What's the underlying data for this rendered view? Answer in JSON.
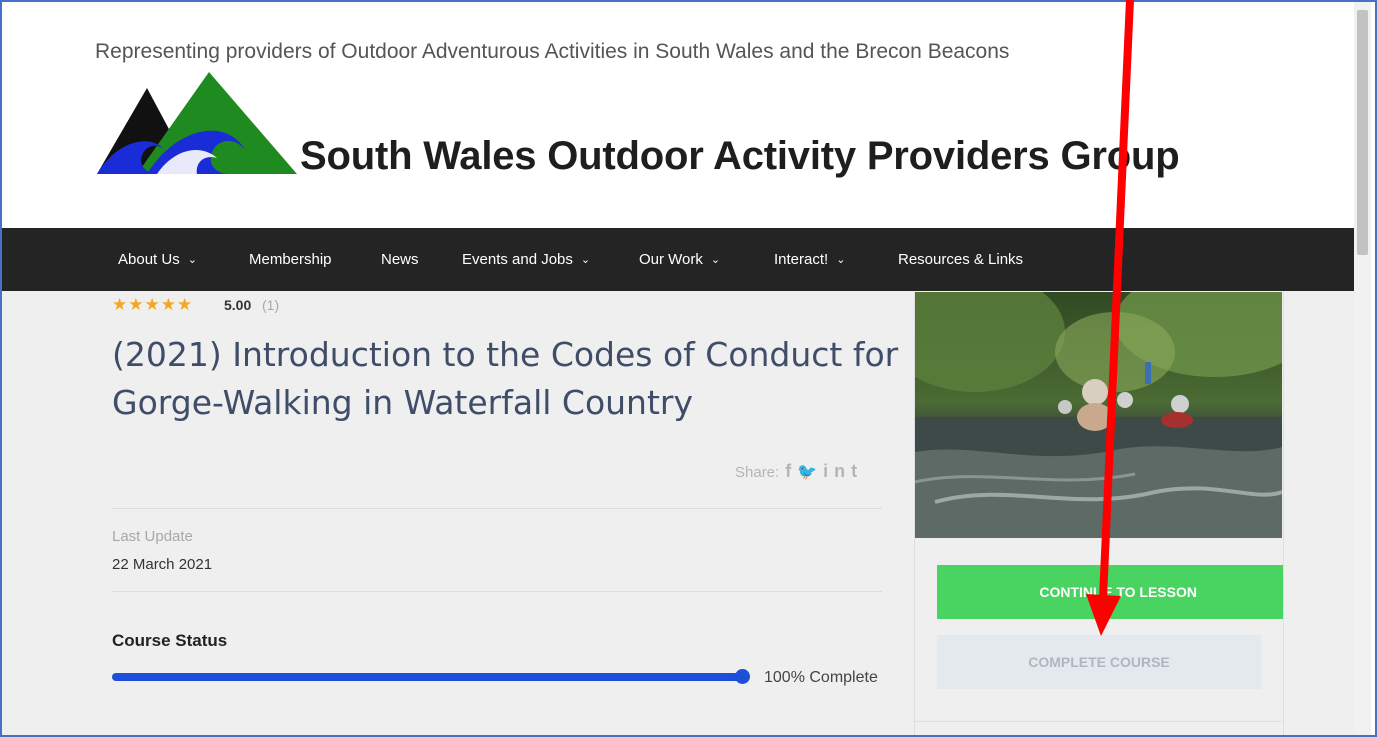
{
  "header": {
    "tagline": "Representing providers of Outdoor Adventurous Activities in South Wales and the Brecon Beacons",
    "site_title": "South Wales Outdoor Activity Providers Group",
    "logo_colors": {
      "black_peak": "#111111",
      "green_peak": "#1f8a1f",
      "wave": "#1a2bd8"
    }
  },
  "nav": {
    "items": [
      {
        "label": "About Us",
        "has_dropdown": true
      },
      {
        "label": "Membership",
        "has_dropdown": false
      },
      {
        "label": "News",
        "has_dropdown": false
      },
      {
        "label": "Events and Jobs",
        "has_dropdown": true
      },
      {
        "label": "Our Work",
        "has_dropdown": true
      },
      {
        "label": "Interact!",
        "has_dropdown": true
      },
      {
        "label": "Resources & Links",
        "has_dropdown": false
      }
    ],
    "dropdown_icon": "chevron-down-icon",
    "background": "#242424"
  },
  "course": {
    "rating": {
      "stars": 5,
      "value": "5.00",
      "count": "(1)"
    },
    "title": "(2021) Introduction to the Codes of Conduct for Gorge-Walking in Waterfall Country",
    "share": {
      "label": "Share:",
      "icons": [
        "facebook-icon",
        "twitter-icon",
        "linkedin-icon",
        "tumblr-icon"
      ]
    },
    "last_update": {
      "label": "Last Update",
      "value": "22 March 2021"
    },
    "status": {
      "label": "Course Status",
      "progress_percent": 100,
      "progress_text": "100% Complete"
    },
    "accent": "#1d4fd8"
  },
  "sidebar": {
    "continue_button": "CONTINUE TO LESSON",
    "complete_button": "COMPLETE COURSE",
    "continue_color": "#49d462"
  },
  "annotation": {
    "arrow_color": "#ff0000"
  }
}
